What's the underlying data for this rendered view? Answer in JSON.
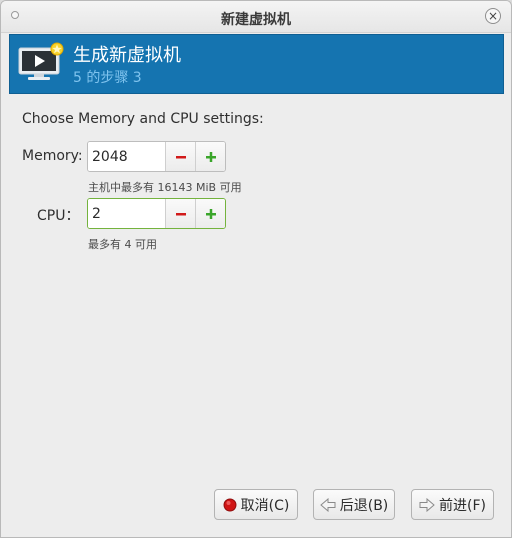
{
  "window": {
    "title": "新建虚拟机"
  },
  "banner": {
    "title": "生成新虚拟机",
    "subtitle": "5 的步骤 3"
  },
  "main": {
    "heading": "Choose Memory and CPU settings:",
    "memory": {
      "label": "Memory:",
      "value": "2048",
      "hint": "主机中最多有 16143 MiB 可用"
    },
    "cpu": {
      "label": "CPU：",
      "value": "2",
      "hint": "最多有 4 可用"
    }
  },
  "buttons": {
    "cancel": "取消(C)",
    "back": "后退(B)",
    "forward": "前进(F)"
  },
  "colors": {
    "banner": "#1574b0",
    "banner_subtitle": "#7fc3ee",
    "minus": "#d11a1a",
    "plus": "#3aa52a",
    "cancel_icon": "#d01515"
  }
}
